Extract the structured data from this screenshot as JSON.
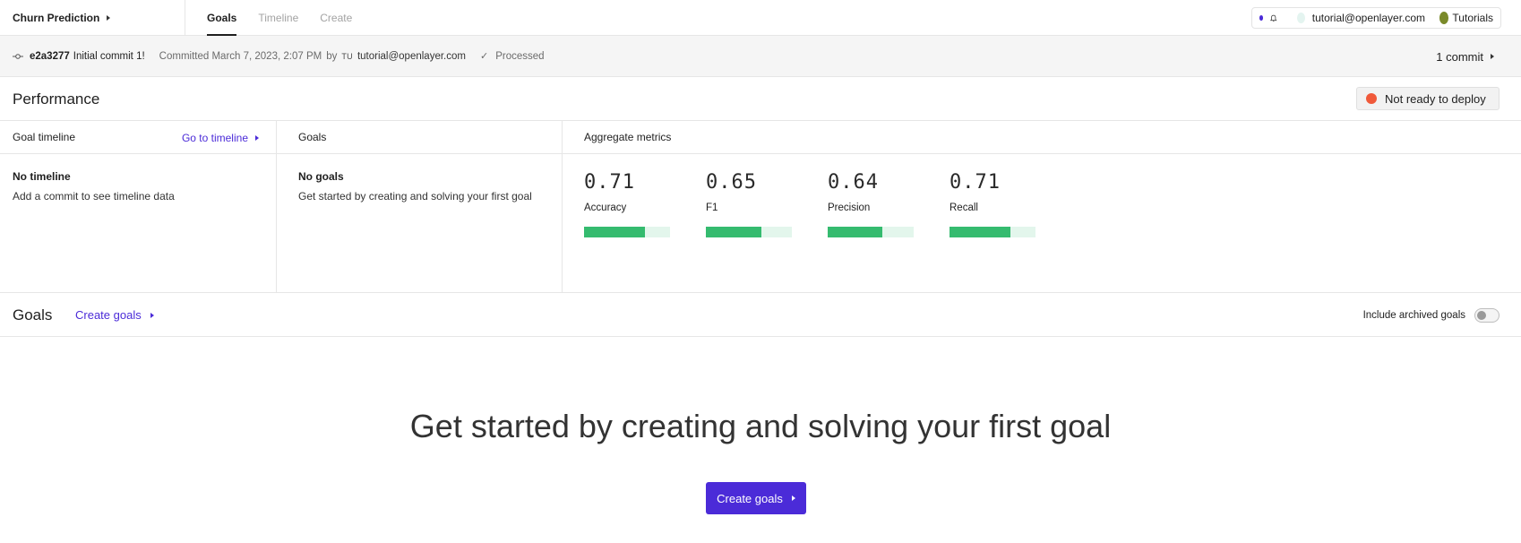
{
  "topbar": {
    "project_name": "Churn Prediction",
    "tabs": [
      {
        "label": "Goals",
        "active": true
      },
      {
        "label": "Timeline",
        "active": false
      },
      {
        "label": "Create",
        "active": false
      }
    ],
    "user_email": "tutorial@openlayer.com",
    "workspace": "Tutorials"
  },
  "commit": {
    "hash": "e2a3277",
    "message": "Initial commit 1!",
    "committed": "Committed March 7, 2023, 2:07 PM",
    "by": "by",
    "initials": "TU",
    "author": "tutorial@openlayer.com",
    "status": "Processed",
    "commits_label": "1 commit"
  },
  "performance": {
    "title": "Performance",
    "deploy_status": "Not ready to deploy",
    "deploy_status_color": "#f0593a",
    "timeline_panel": {
      "title": "Goal timeline",
      "link": "Go to timeline",
      "empty_title": "No timeline",
      "empty_sub": "Add a commit to see timeline data"
    },
    "goals_panel": {
      "title": "Goals",
      "empty_title": "No goals",
      "empty_sub": "Get started by creating and solving your first goal"
    },
    "metrics_panel": {
      "title": "Aggregate metrics",
      "metrics": [
        {
          "value": "0.71",
          "label": "Accuracy",
          "fraction": 0.71
        },
        {
          "value": "0.65",
          "label": "F1",
          "fraction": 0.65
        },
        {
          "value": "0.64",
          "label": "Precision",
          "fraction": 0.64
        },
        {
          "value": "0.71",
          "label": "Recall",
          "fraction": 0.71
        }
      ]
    }
  },
  "goals": {
    "title": "Goals",
    "create_link": "Create goals",
    "archived_label": "Include archived goals",
    "archived_enabled": false,
    "hero_text": "Get started by creating and solving your first goal",
    "cta_label": "Create goals"
  },
  "colors": {
    "accent": "#4b2bd8",
    "metric_bar": "#35bb6f",
    "metric_bar_track": "#e3f6ec"
  }
}
